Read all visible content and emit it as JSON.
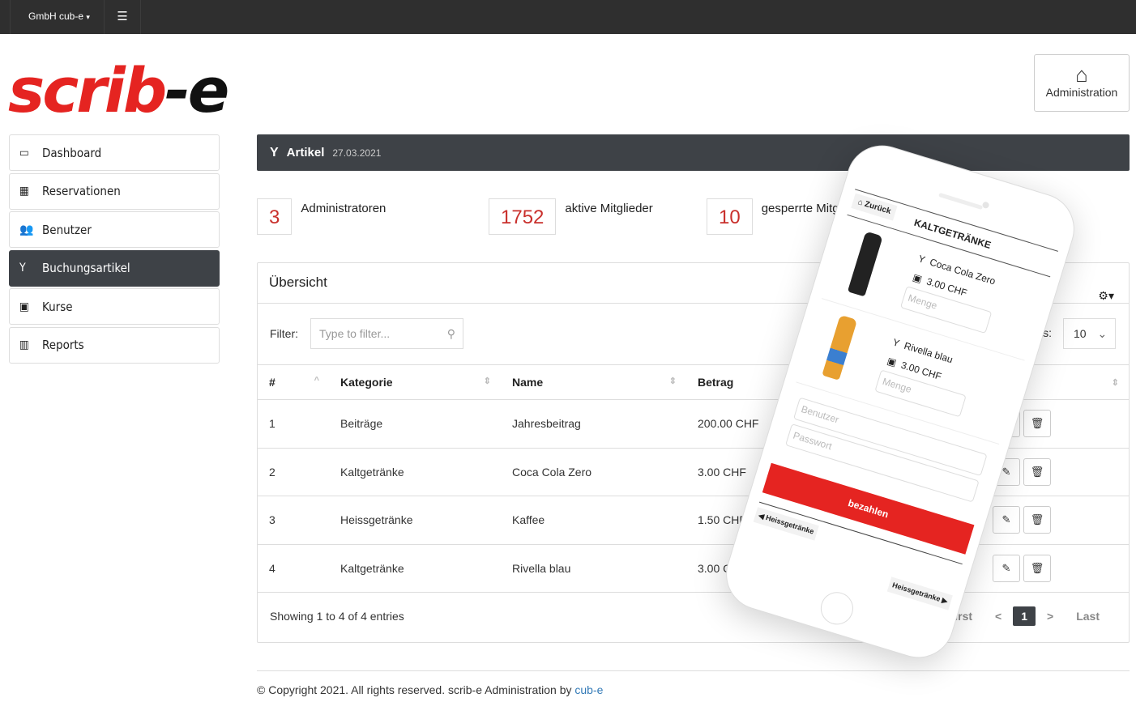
{
  "topbar": {
    "org": "GmbH cub-e",
    "org_caret": "▾",
    "menu_icon": "☰"
  },
  "logo": {
    "red": "scrib",
    "black": "-e"
  },
  "admin_button": {
    "label": "Administration",
    "icon": "home-icon"
  },
  "sidebar": {
    "items": [
      {
        "label": "Dashboard",
        "icon": "laptop-icon",
        "glyph": "💻"
      },
      {
        "label": "Reservationen",
        "icon": "table-icon",
        "glyph": "▦"
      },
      {
        "label": "Benutzer",
        "icon": "users-icon",
        "glyph": "👥"
      },
      {
        "label": "Buchungsartikel",
        "icon": "glass-icon",
        "glyph": "Y",
        "active": true
      },
      {
        "label": "Kurse",
        "icon": "calendar-icon",
        "glyph": "📅"
      },
      {
        "label": "Reports",
        "icon": "bar-chart-icon",
        "glyph": "📊"
      }
    ]
  },
  "header": {
    "title": "Artikel",
    "date": "27.03.2021"
  },
  "stats": [
    {
      "value": "3",
      "label": "Administratoren"
    },
    {
      "value": "1752",
      "label": "aktive Mitglieder"
    },
    {
      "value": "10",
      "label": "gesperrte Mitglieder"
    }
  ],
  "panel": {
    "title": "Übersicht",
    "filter_label": "Filter:",
    "filter_placeholder": "Type to filter...",
    "length_label": "entries:",
    "length_value": "10",
    "columns": [
      "#",
      "Kategorie",
      "Name",
      "Betrag",
      ""
    ],
    "rows": [
      [
        "1",
        "Beiträge",
        "Jahresbeitrag",
        "200.00 CHF"
      ],
      [
        "2",
        "Kaltgetränke",
        "Coca Cola Zero",
        "3.00 CHF"
      ],
      [
        "3",
        "Heissgetränke",
        "Kaffee",
        "1.50 CHF"
      ],
      [
        "4",
        "Kaltgetränke",
        "Rivella blau",
        "3.00 CHF"
      ]
    ],
    "info": "Showing 1 to 4 of 4 entries",
    "pagination": {
      "first": "First",
      "prev": "<",
      "current": "1",
      "next": ">",
      "last": "Last"
    }
  },
  "footer": {
    "text": "© Copyright 2021. All rights reserved. scrib-e Administration by ",
    "link": "cub-e"
  },
  "phone": {
    "back": "Zurück",
    "category": "KALTGETRÄNKE",
    "products": [
      {
        "name": "Coca Cola Zero",
        "price": "3.00 CHF",
        "qty_placeholder": "Menge"
      },
      {
        "name": "Rivella blau",
        "price": "3.00 CHF",
        "qty_placeholder": "Menge"
      }
    ],
    "user_placeholder": "Benutzer",
    "password_placeholder": "Passwort",
    "pay": "bezahlen",
    "prev_cat": "Heissgetränke",
    "next_cat": "Heissgetränke"
  },
  "colors": {
    "brand_red": "#e52421",
    "dark": "#3e4247",
    "topbar": "#2f2f2f",
    "stat_number": "#c9302c"
  }
}
